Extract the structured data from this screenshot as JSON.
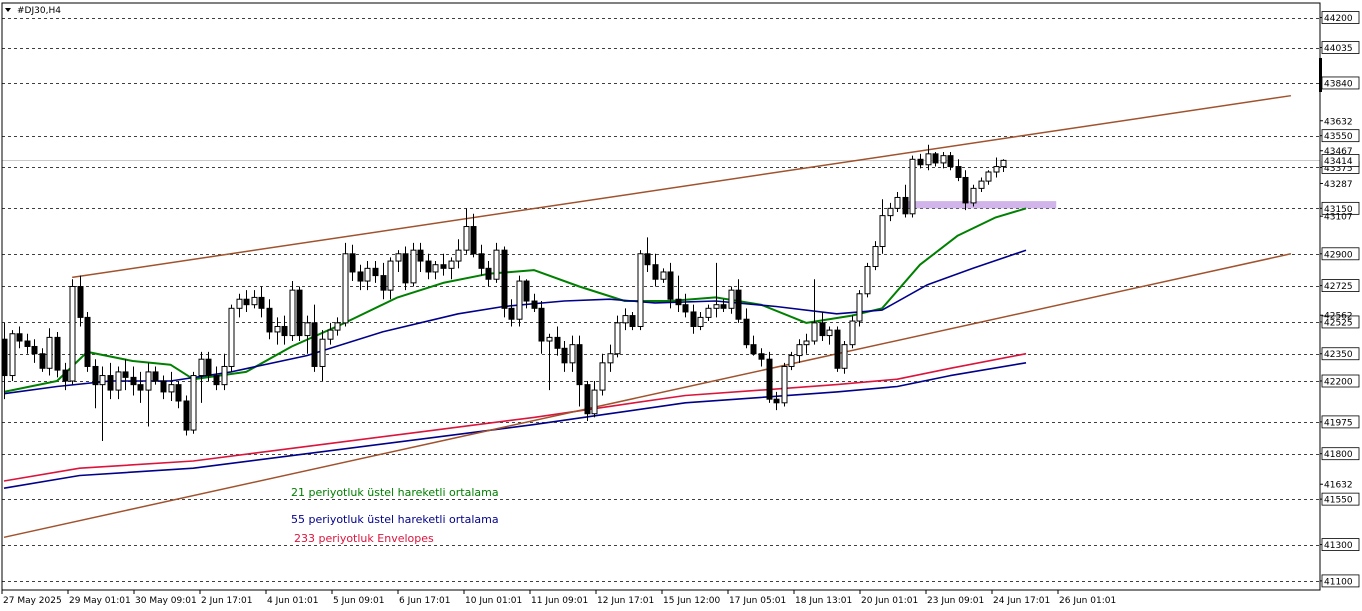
{
  "window": {
    "title": "#DJ30,H4"
  },
  "colors": {
    "background": "#ffffff",
    "grid": "#000000",
    "candle": "#000000",
    "ema21": "#008000",
    "ema55": "#00008b",
    "envelope": "#dc143c",
    "channel": "#a0522d",
    "zone": "#c9a8e6"
  },
  "legend": [
    {
      "text": "21 periyotluk üstel hareketli ortalama",
      "color": "#008000"
    },
    {
      "text": "55 periyotluk üstel hareketli ortalama",
      "color": "#00008b"
    },
    {
      "text": "233 periyotluk Envelopes",
      "color": "#dc143c"
    }
  ],
  "chart_data": {
    "type": "candlestick",
    "symbol": "#DJ30",
    "timeframe": "H4",
    "ylim": [
      41050,
      44280
    ],
    "grid": true,
    "current_price": "43414",
    "y_ticks": [
      {
        "value": 44200,
        "text": "44200",
        "boxed": true
      },
      {
        "value": 44035,
        "text": "44035",
        "boxed": true
      },
      {
        "value": 43840,
        "text": "43840",
        "boxed": true
      },
      {
        "value": 43550,
        "text": "43550",
        "boxed": true
      },
      {
        "value": 43375,
        "text": "43375",
        "boxed": true
      },
      {
        "value": 43150,
        "text": "43150",
        "boxed": true
      },
      {
        "value": 42900,
        "text": "42900",
        "boxed": true
      },
      {
        "value": 42725,
        "text": "42725",
        "boxed": true
      },
      {
        "value": 42525,
        "text": "42525",
        "boxed": true
      },
      {
        "value": 42350,
        "text": "42350",
        "boxed": true
      },
      {
        "value": 42200,
        "text": "42200",
        "boxed": true
      },
      {
        "value": 41975,
        "text": "41975",
        "boxed": true
      },
      {
        "value": 41800,
        "text": "41800",
        "boxed": true
      },
      {
        "value": 41550,
        "text": "41550",
        "boxed": true
      },
      {
        "value": 41300,
        "text": "41300",
        "boxed": true
      },
      {
        "value": 41100,
        "text": "41100",
        "boxed": true
      },
      {
        "value": 43632,
        "text": "43632",
        "boxed": false
      },
      {
        "value": 43467,
        "text": "43467",
        "boxed": false
      },
      {
        "value": 43287,
        "text": "43287",
        "boxed": false
      },
      {
        "value": 43107,
        "text": "43107",
        "boxed": false
      },
      {
        "value": 42562,
        "text": "42562",
        "boxed": false
      },
      {
        "value": 41632,
        "text": "41632",
        "boxed": false
      }
    ],
    "x_labels": [
      "27 May 2025",
      "29 May 01:01",
      "30 May 09:01",
      "2 Jun 17:01",
      "4 Jun 01:01",
      "5 Jun 09:01",
      "6 Jun 17:01",
      "10 Jun 01:01",
      "11 Jun 09:01",
      "12 Jun 17:01",
      "15 Jun 12:00",
      "17 Jun 05:01",
      "18 Jun 13:01",
      "20 Jun 01:01",
      "23 Jun 09:01",
      "24 Jun 17:01",
      "26 Jun 01:01"
    ],
    "candles": [
      [
        42430,
        42520,
        42100,
        42230
      ],
      [
        42230,
        42480,
        42200,
        42460
      ],
      [
        42460,
        42500,
        42380,
        42420
      ],
      [
        42420,
        42460,
        42350,
        42390
      ],
      [
        42390,
        42430,
        42300,
        42350
      ],
      [
        42350,
        42380,
        42250,
        42270
      ],
      [
        42270,
        42490,
        42230,
        42440
      ],
      [
        42440,
        42470,
        42220,
        42260
      ],
      [
        42260,
        42300,
        42150,
        42200
      ],
      [
        42200,
        42760,
        42180,
        42720
      ],
      [
        42720,
        42780,
        42500,
        42550
      ],
      [
        42550,
        42580,
        42250,
        42280
      ],
      [
        42280,
        42320,
        42050,
        42180
      ],
      [
        42180,
        42280,
        41870,
        42230
      ],
      [
        42230,
        42300,
        42100,
        42150
      ],
      [
        42150,
        42280,
        42100,
        42250
      ],
      [
        42250,
        42320,
        42150,
        42220
      ],
      [
        42220,
        42280,
        42120,
        42180
      ],
      [
        42180,
        42250,
        42080,
        42150
      ],
      [
        42150,
        42300,
        41950,
        42250
      ],
      [
        42250,
        42280,
        42180,
        42200
      ],
      [
        42200,
        42230,
        42100,
        42140
      ],
      [
        42140,
        42250,
        42090,
        42180
      ],
      [
        42180,
        42200,
        42050,
        42090
      ],
      [
        42090,
        42120,
        41900,
        41930
      ],
      [
        41930,
        42250,
        41910,
        42230
      ],
      [
        42230,
        42360,
        42080,
        42320
      ],
      [
        42320,
        42360,
        42200,
        42230
      ],
      [
        42230,
        42280,
        42150,
        42180
      ],
      [
        42180,
        42350,
        42150,
        42280
      ],
      [
        42280,
        42620,
        42250,
        42600
      ],
      [
        42600,
        42680,
        42550,
        42650
      ],
      [
        42650,
        42700,
        42580,
        42620
      ],
      [
        42620,
        42700,
        42600,
        42660
      ],
      [
        42660,
        42720,
        42550,
        42600
      ],
      [
        42600,
        42650,
        42430,
        42470
      ],
      [
        42470,
        42550,
        42400,
        42500
      ],
      [
        42500,
        42560,
        42400,
        42450
      ],
      [
        42450,
        42750,
        42420,
        42700
      ],
      [
        42700,
        42720,
        42420,
        42450
      ],
      [
        42450,
        42560,
        42350,
        42520
      ],
      [
        42520,
        42620,
        42250,
        42280
      ],
      [
        42280,
        42480,
        42200,
        42430
      ],
      [
        42430,
        42520,
        42400,
        42480
      ],
      [
        42480,
        42550,
        42450,
        42520
      ],
      [
        42520,
        42960,
        42500,
        42900
      ],
      [
        42900,
        42950,
        42750,
        42800
      ],
      [
        42800,
        42840,
        42700,
        42750
      ],
      [
        42750,
        42860,
        42700,
        42820
      ],
      [
        42820,
        42860,
        42740,
        42780
      ],
      [
        42780,
        42850,
        42650,
        42700
      ],
      [
        42700,
        42880,
        42650,
        42860
      ],
      [
        42860,
        42920,
        42800,
        42900
      ],
      [
        42900,
        42940,
        42700,
        42740
      ],
      [
        42740,
        42960,
        42720,
        42920
      ],
      [
        42920,
        42960,
        42800,
        42860
      ],
      [
        42860,
        42900,
        42760,
        42800
      ],
      [
        42800,
        42860,
        42760,
        42840
      ],
      [
        42840,
        42900,
        42780,
        42820
      ],
      [
        42820,
        42880,
        42760,
        42860
      ],
      [
        42860,
        42980,
        42820,
        42920
      ],
      [
        42920,
        43150,
        42900,
        43050
      ],
      [
        43050,
        43120,
        42880,
        42900
      ],
      [
        42900,
        42950,
        42780,
        42820
      ],
      [
        42820,
        42860,
        42720,
        42760
      ],
      [
        42760,
        42960,
        42740,
        42920
      ],
      [
        42920,
        42940,
        42550,
        42600
      ],
      [
        42600,
        42650,
        42500,
        42540
      ],
      [
        42540,
        42780,
        42500,
        42750
      ],
      [
        42750,
        42760,
        42600,
        42640
      ],
      [
        42640,
        42680,
        42580,
        42600
      ],
      [
        42600,
        42640,
        42350,
        42420
      ],
      [
        42420,
        42460,
        42150,
        42440
      ],
      [
        42440,
        42500,
        42340,
        42380
      ],
      [
        42380,
        42420,
        42250,
        42300
      ],
      [
        42300,
        42450,
        42250,
        42400
      ],
      [
        42400,
        42450,
        42060,
        42180
      ],
      [
        42180,
        42200,
        41980,
        42020
      ],
      [
        42020,
        42200,
        42000,
        42150
      ],
      [
        42150,
        42350,
        42120,
        42300
      ],
      [
        42300,
        42400,
        42250,
        42350
      ],
      [
        42350,
        42560,
        42330,
        42520
      ],
      [
        42520,
        42600,
        42480,
        42560
      ],
      [
        42560,
        42580,
        42480,
        42500
      ],
      [
        42500,
        42920,
        42480,
        42900
      ],
      [
        42900,
        42990,
        42800,
        42840
      ],
      [
        42840,
        42900,
        42720,
        42760
      ],
      [
        42760,
        42820,
        42740,
        42800
      ],
      [
        42800,
        42850,
        42600,
        42650
      ],
      [
        42650,
        42780,
        42580,
        42620
      ],
      [
        42620,
        42680,
        42550,
        42580
      ],
      [
        42580,
        42620,
        42460,
        42500
      ],
      [
        42500,
        42580,
        42480,
        42550
      ],
      [
        42550,
        42620,
        42530,
        42600
      ],
      [
        42600,
        42850,
        42550,
        42620
      ],
      [
        42620,
        42650,
        42580,
        42600
      ],
      [
        42600,
        42720,
        42570,
        42700
      ],
      [
        42700,
        42760,
        42520,
        42540
      ],
      [
        42540,
        42600,
        42380,
        42400
      ],
      [
        42400,
        42450,
        42340,
        42350
      ],
      [
        42350,
        42380,
        42280,
        42320
      ],
      [
        42320,
        42360,
        42080,
        42100
      ],
      [
        42100,
        42140,
        42040,
        42080
      ],
      [
        42080,
        42300,
        42060,
        42280
      ],
      [
        42280,
        42360,
        42260,
        42340
      ],
      [
        42340,
        42430,
        42300,
        42400
      ],
      [
        42400,
        42460,
        42350,
        42420
      ],
      [
        42420,
        42760,
        42400,
        42520
      ],
      [
        42520,
        42580,
        42420,
        42450
      ],
      [
        42450,
        42500,
        42400,
        42480
      ],
      [
        42480,
        42500,
        42250,
        42270
      ],
      [
        42270,
        42420,
        42240,
        42400
      ],
      [
        42400,
        42560,
        42380,
        42530
      ],
      [
        42530,
        42700,
        42500,
        42680
      ],
      [
        42680,
        42850,
        42660,
        42830
      ],
      [
        42830,
        42970,
        42810,
        42940
      ],
      [
        42940,
        43200,
        42900,
        43110
      ],
      [
        43110,
        43180,
        43080,
        43150
      ],
      [
        43150,
        43240,
        43130,
        43210
      ],
      [
        43210,
        43280,
        43100,
        43120
      ],
      [
        43120,
        43440,
        43100,
        43420
      ],
      [
        43420,
        43450,
        43370,
        43390
      ],
      [
        43390,
        43500,
        43360,
        43450
      ],
      [
        43450,
        43460,
        43380,
        43400
      ],
      [
        43400,
        43460,
        43370,
        43440
      ],
      [
        43440,
        43460,
        43360,
        43380
      ],
      [
        43380,
        43420,
        43300,
        43320
      ],
      [
        43320,
        43360,
        43140,
        43180
      ],
      [
        43180,
        43280,
        43160,
        43260
      ],
      [
        43260,
        43320,
        43240,
        43300
      ],
      [
        43300,
        43360,
        43280,
        43350
      ],
      [
        43350,
        43430,
        43320,
        43380
      ],
      [
        43380,
        43420,
        43350,
        43414
      ]
    ],
    "series": [
      {
        "name": "21 periyotluk üstel hareketli ortalama",
        "color": "#008000",
        "points": [
          [
            0,
            42140
          ],
          [
            7,
            42200
          ],
          [
            11,
            42360
          ],
          [
            17,
            42310
          ],
          [
            22,
            42290
          ],
          [
            25,
            42210
          ],
          [
            32,
            42250
          ],
          [
            38,
            42390
          ],
          [
            45,
            42520
          ],
          [
            52,
            42660
          ],
          [
            58,
            42740
          ],
          [
            64,
            42790
          ],
          [
            70,
            42810
          ],
          [
            76,
            42720
          ],
          [
            82,
            42640
          ],
          [
            88,
            42640
          ],
          [
            94,
            42660
          ],
          [
            100,
            42620
          ],
          [
            106,
            42520
          ],
          [
            112,
            42560
          ],
          [
            116,
            42600
          ],
          [
            121,
            42840
          ],
          [
            126,
            43000
          ],
          [
            131,
            43100
          ],
          [
            135,
            43150
          ]
        ]
      },
      {
        "name": "55 periyotluk üstel hareketli ortalama",
        "color": "#00008b",
        "points": [
          [
            0,
            42130
          ],
          [
            7,
            42170
          ],
          [
            14,
            42200
          ],
          [
            22,
            42200
          ],
          [
            30,
            42250
          ],
          [
            40,
            42340
          ],
          [
            50,
            42470
          ],
          [
            60,
            42570
          ],
          [
            66,
            42610
          ],
          [
            74,
            42640
          ],
          [
            80,
            42650
          ],
          [
            86,
            42630
          ],
          [
            94,
            42640
          ],
          [
            102,
            42610
          ],
          [
            110,
            42570
          ],
          [
            116,
            42590
          ],
          [
            122,
            42730
          ],
          [
            128,
            42820
          ],
          [
            135,
            42920
          ]
        ]
      },
      {
        "name": "233 periyotluk Envelopes (upper)",
        "color": "#dc143c",
        "points": [
          [
            0,
            41650
          ],
          [
            10,
            41720
          ],
          [
            25,
            41760
          ],
          [
            40,
            41840
          ],
          [
            55,
            41920
          ],
          [
            70,
            42000
          ],
          [
            80,
            42060
          ],
          [
            90,
            42120
          ],
          [
            100,
            42150
          ],
          [
            110,
            42180
          ],
          [
            118,
            42210
          ],
          [
            125,
            42270
          ],
          [
            135,
            42350
          ]
        ]
      },
      {
        "name": "233 periyotluk Envelopes (lower)",
        "color": "#00008b",
        "points": [
          [
            0,
            41610
          ],
          [
            10,
            41680
          ],
          [
            25,
            41720
          ],
          [
            40,
            41800
          ],
          [
            55,
            41880
          ],
          [
            70,
            41960
          ],
          [
            80,
            42020
          ],
          [
            90,
            42080
          ],
          [
            100,
            42110
          ],
          [
            110,
            42140
          ],
          [
            118,
            42170
          ],
          [
            125,
            42230
          ],
          [
            135,
            42300
          ]
        ]
      }
    ],
    "channel_lines": [
      {
        "from": [
          9,
          42770
        ],
        "to": [
          170,
          43770
        ]
      },
      {
        "from": [
          0,
          41340
        ],
        "to": [
          170,
          42900
        ]
      }
    ],
    "support_zone": {
      "from": 119,
      "to": 139,
      "low": 43150,
      "high": 43190
    }
  }
}
